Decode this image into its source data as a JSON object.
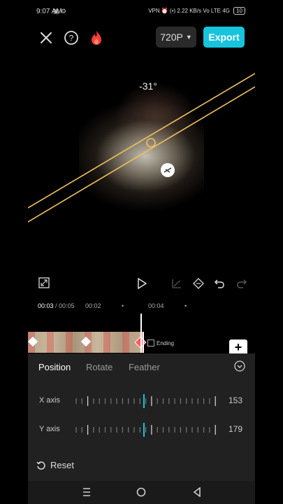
{
  "status_bar": {
    "time": "9:07 AM",
    "signal_text": "VPN  ⏰  (•) 2.22 KB/s  Vo LTE  4G  ",
    "battery": "10"
  },
  "top_bar": {
    "resolution": "720P",
    "export_label": "Export",
    "close_icon": "close-icon",
    "help_icon": "help-icon",
    "fire_icon": "fire-icon"
  },
  "preview": {
    "angle": "-31°"
  },
  "timeline": {
    "current_time": "00:03",
    "total_time": "/ 00:05",
    "tick_1": "00:02",
    "tick_2": "00:04",
    "ending_label": "Ending"
  },
  "panel": {
    "tabs": [
      "Position",
      "Rotate",
      "Feather"
    ],
    "active_tab": "Position",
    "x_axis": {
      "label": "X axis",
      "value": "153"
    },
    "y_axis": {
      "label": "Y axis",
      "value": "179"
    },
    "reset_label": "Reset"
  },
  "colors": {
    "accent": "#17c4dc",
    "mask_line": "#f0c060",
    "fire": "#ff3b3b"
  }
}
